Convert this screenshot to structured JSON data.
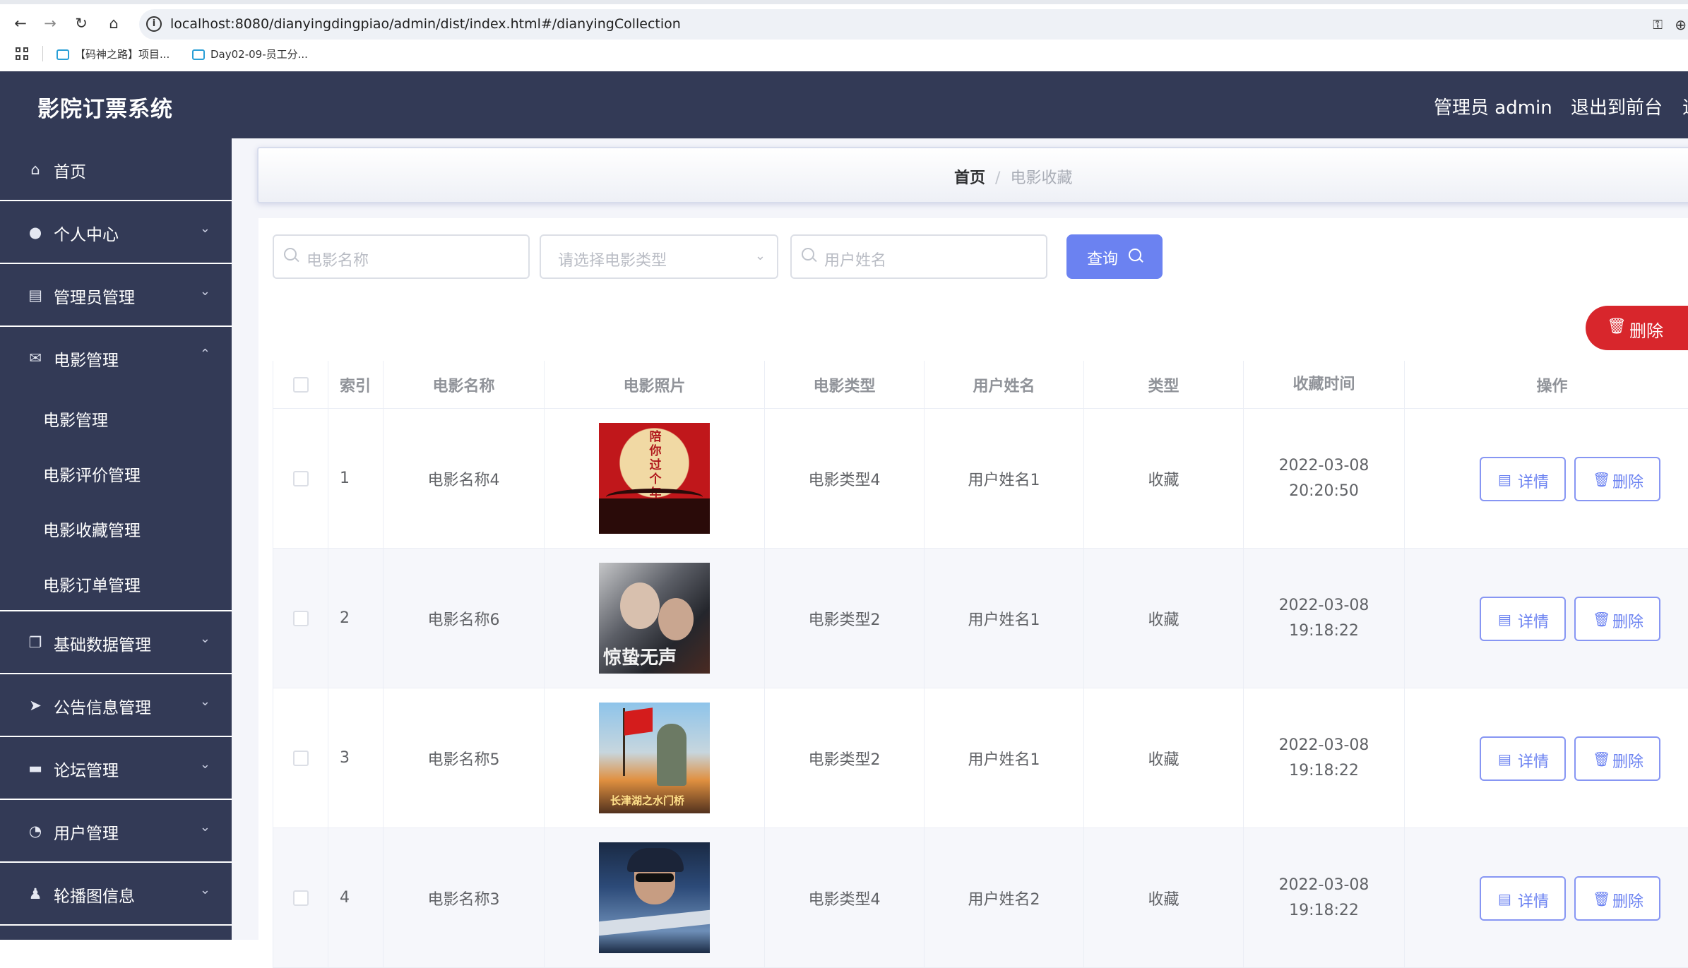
{
  "browser": {
    "url": "localhost:8080/dianyingdingpiao/admin/dist/index.html#/dianyingCollection",
    "bookmarks": [
      {
        "label": "【码神之路】项目..."
      },
      {
        "label": "Day02-09-员工分..."
      }
    ]
  },
  "header": {
    "title": "影院订票系统",
    "admin_label": "管理员 admin",
    "exit_label": "退出到前台",
    "more_label": "退"
  },
  "sidebar": {
    "items": [
      {
        "label": "首页",
        "icon": "home-icon"
      },
      {
        "label": "个人中心",
        "icon": "user-icon"
      },
      {
        "label": "管理员管理",
        "icon": "id-card-icon"
      },
      {
        "label": "电影管理",
        "icon": "mail-icon"
      },
      {
        "label": "基础数据管理",
        "icon": "copy-icon"
      },
      {
        "label": "公告信息管理",
        "icon": "send-icon"
      },
      {
        "label": "论坛管理",
        "icon": "chat-icon"
      },
      {
        "label": "用户管理",
        "icon": "gauge-icon"
      },
      {
        "label": "轮播图信息",
        "icon": "person-icon"
      }
    ],
    "submenu": [
      {
        "label": "电影管理"
      },
      {
        "label": "电影评价管理"
      },
      {
        "label": "电影收藏管理"
      },
      {
        "label": "电影订单管理"
      }
    ]
  },
  "breadcrumb": {
    "home": "首页",
    "separator": "/",
    "current": "电影收藏"
  },
  "search": {
    "movie_name_placeholder": "电影名称",
    "movie_type_placeholder": "请选择电影类型",
    "user_name_placeholder": "用户姓名",
    "query_label": "查询"
  },
  "bulk_delete_label": "删除",
  "table": {
    "headers": {
      "index": "索引",
      "name": "电影名称",
      "photo": "电影照片",
      "movie_type": "电影类型",
      "user": "用户姓名",
      "type": "类型",
      "time": "收藏时间",
      "ops": "操作"
    },
    "rows": [
      {
        "index": "1",
        "name": "电影名称4",
        "movie_type": "电影类型4",
        "user": "用户姓名1",
        "type": "收藏",
        "time": "2022-03-08 20:20:50",
        "poster_text": "陪你过个年"
      },
      {
        "index": "2",
        "name": "电影名称6",
        "movie_type": "电影类型2",
        "user": "用户姓名1",
        "type": "收藏",
        "time": "2022-03-08 19:18:22",
        "poster_text": "惊蛰无声"
      },
      {
        "index": "3",
        "name": "电影名称5",
        "movie_type": "电影类型2",
        "user": "用户姓名1",
        "type": "收藏",
        "time": "2022-03-08 19:18:22",
        "poster_text": "长津湖之水门桥"
      },
      {
        "index": "4",
        "name": "电影名称3",
        "movie_type": "电影类型4",
        "user": "用户姓名2",
        "type": "收藏",
        "time": "2022-03-08 19:18:22",
        "poster_text": ""
      }
    ],
    "detail_label": "详情",
    "delete_label": "删除"
  },
  "colors": {
    "sidebar_bg": "#333a56",
    "primary": "#6b82f1",
    "danger": "#d8262c"
  }
}
